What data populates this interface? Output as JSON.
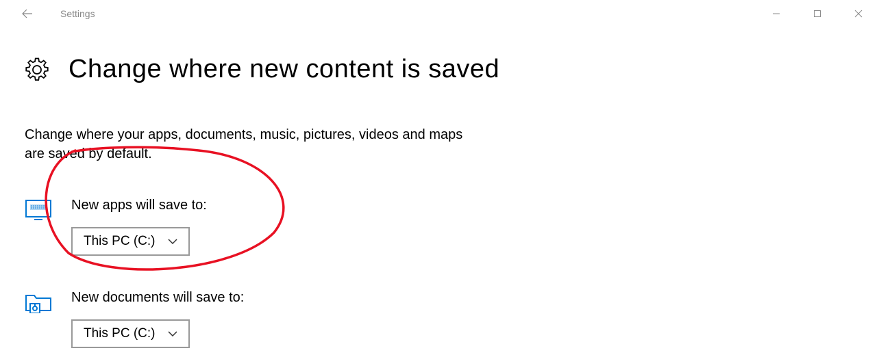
{
  "titlebar": {
    "app_name": "Settings"
  },
  "page": {
    "title": "Change where new content is saved",
    "description": "Change where your apps, documents, music, pictures, videos and maps are saved by default."
  },
  "settings": {
    "apps": {
      "label": "New apps will save to:",
      "value": "This PC (C:)"
    },
    "documents": {
      "label": "New documents will save to:",
      "value": "This PC (C:)"
    }
  }
}
